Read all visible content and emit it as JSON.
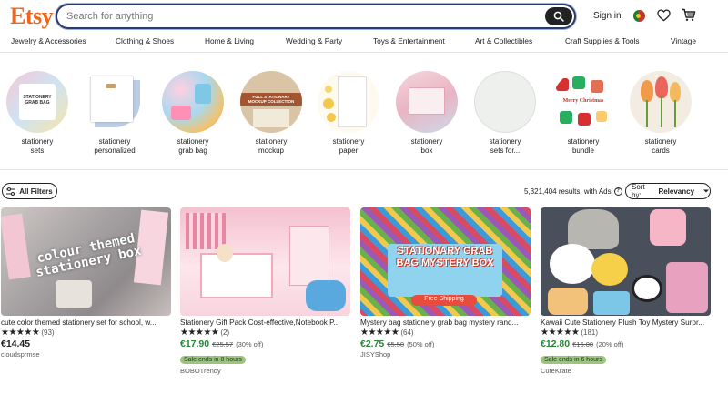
{
  "header": {
    "logo": "Etsy",
    "search_placeholder": "Search for anything",
    "sign_in": "Sign in"
  },
  "category_nav": [
    "Jewelry & Accessories",
    "Clothing & Shoes",
    "Home & Living",
    "Wedding & Party",
    "Toys & Entertainment",
    "Art & Collectibles",
    "Craft Supplies & Tools",
    "Vintage"
  ],
  "related_searches": [
    {
      "line1": "stationery",
      "line2": "sets"
    },
    {
      "line1": "stationery",
      "line2": "personalized"
    },
    {
      "line1": "stationery",
      "line2": "grab bag"
    },
    {
      "line1": "stationery",
      "line2": "mockup"
    },
    {
      "line1": "stationery",
      "line2": "paper"
    },
    {
      "line1": "stationery",
      "line2": "box"
    },
    {
      "line1": "stationery",
      "line2": "sets for..."
    },
    {
      "line1": "stationery",
      "line2": "bundle"
    },
    {
      "line1": "stationery",
      "line2": "cards"
    }
  ],
  "circle_image_text": {
    "sets": "STATIONERY GRAB BAG",
    "mockup": "FULL STATIONARY MOCKUP COLLECTION",
    "bundle": "Merry Christmas"
  },
  "filters": {
    "all_filters": "All Filters",
    "results": "5,321,404 results, with Ads",
    "sort_label": "Sort by:",
    "sort_value": "Relevancy"
  },
  "products": [
    {
      "title": "cute color themed stationery set for school, w...",
      "stars": "★★★★★",
      "reviews": "(93)",
      "price": "€14.45",
      "original_price": "",
      "discount": "",
      "badge": "",
      "shop": "cloudsprmse",
      "image_text": "colour themed stationery box"
    },
    {
      "title": "Stationery Gift Pack Cost-effective,Notebook P...",
      "stars": "★★★★★",
      "reviews": "(2)",
      "price": "€17.90",
      "original_price": "€25.57",
      "discount": "(30% off)",
      "badge": "Sale ends in 8 hours",
      "shop": "BOBOTrendy",
      "image_text": ""
    },
    {
      "title": "Mystery bag stationery grab bag mystery rand...",
      "stars": "★★★★★",
      "reviews": "(64)",
      "price": "€2.75",
      "original_price": "€5.50",
      "discount": "(50% off)",
      "badge": "",
      "shop": "JISYShop",
      "image_text": "STATIONARY GRAB BAG MYSTERY BOX",
      "image_subtext": "Free Shipping"
    },
    {
      "title": "Kawaii Cute Stationery Plush Toy Mystery Surpr...",
      "stars": "★★★★★",
      "reviews": "(181)",
      "price": "€12.80",
      "original_price": "€16.00",
      "discount": "(20% off)",
      "badge": "Sale ends in 6 hours",
      "shop": "CuteKrate",
      "image_text": ""
    }
  ]
}
